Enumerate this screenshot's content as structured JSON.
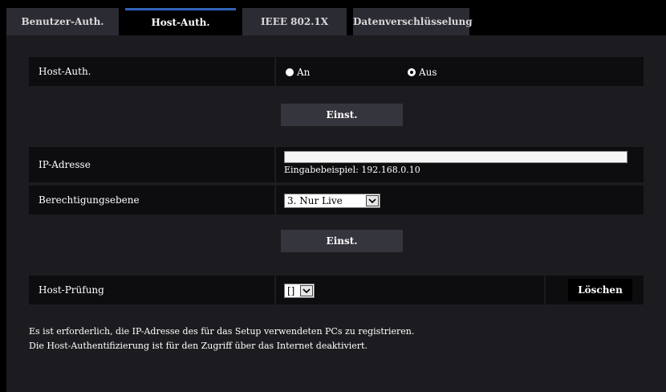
{
  "tabs": [
    {
      "label": "Benutzer-Auth."
    },
    {
      "label": "Host-Auth."
    },
    {
      "label": "IEEE 802.1X"
    },
    {
      "label": "Datenverschlüsselung"
    }
  ],
  "host_auth": {
    "label": "Host-Auth.",
    "option_on": "An",
    "option_off": "Aus",
    "selected": "Aus"
  },
  "set_button_1": "Einst.",
  "ip": {
    "label": "IP-Adresse",
    "value": "",
    "hint": "Eingabebeispiel: 192.168.0.10"
  },
  "level": {
    "label": "Berechtigungsebene",
    "selected": "3. Nur Live"
  },
  "set_button_2": "Einst.",
  "host_check": {
    "label": "Host-Prüfung",
    "selected": "[]",
    "delete_label": "Löschen"
  },
  "notes": [
    "Es ist erforderlich, die IP-Adresse des für das Setup verwendeten PCs zu registrieren.",
    "Die Host-Authentifizierung ist für den Zugriff über das Internet deaktiviert."
  ],
  "colors": {
    "accent": "#2f63b8",
    "tab_bg": "#2b2b33",
    "content_bg": "#1c1c20",
    "row_bg": "#0d0d10",
    "button_bg": "#35353d"
  }
}
